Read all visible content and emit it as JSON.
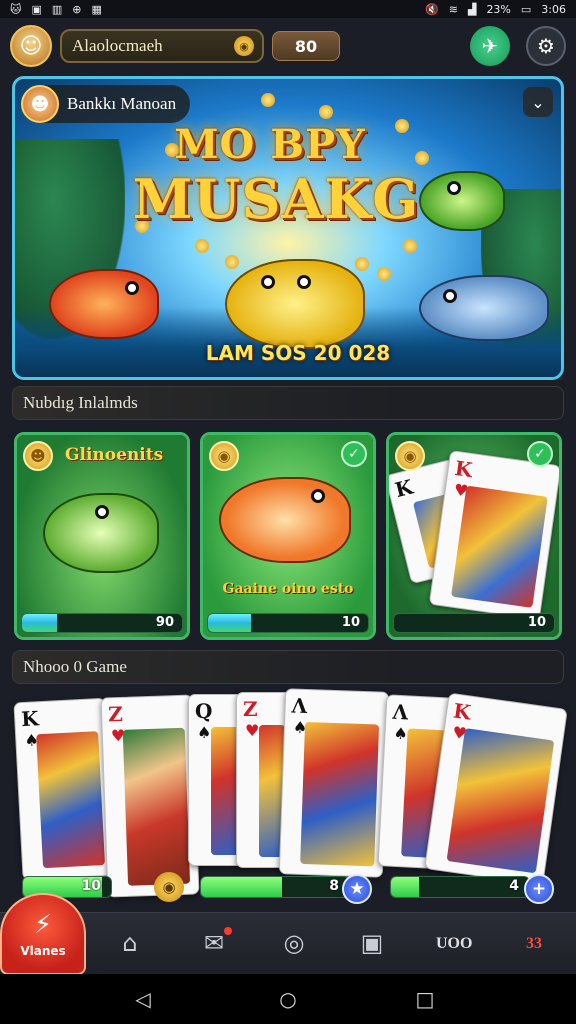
{
  "status_bar": {
    "left_icons": [
      "cat-icon",
      "image-icon",
      "bars-icon",
      "game-icon",
      "square-icon"
    ],
    "right_text": "23%",
    "time": "3:06"
  },
  "top_bar": {
    "username": "Alaolocmaeh",
    "balance": "80"
  },
  "hero": {
    "badge_text": "Bankkı Manoan",
    "title_line1": "MO BPY",
    "title_line2": "MUSAKG",
    "date_text": "LAM SOS 20 028"
  },
  "sections": {
    "featured_title": "Nubdıg Inlalmds",
    "second_title": "Nhooo 0 Game"
  },
  "featured_cards": [
    {
      "title": "Glinoenits",
      "caption": "",
      "progress_value": "90",
      "progress_fraction": 0.22
    },
    {
      "title": "",
      "caption": "Gaaine oino esto",
      "progress_value": "10",
      "progress_fraction": 0.27
    },
    {
      "title": "",
      "caption": "",
      "progress_value": "10",
      "progress_fraction": 0.0
    }
  ],
  "card_row": {
    "cards": [
      {
        "rank": "K",
        "suit": "♠",
        "color": "black"
      },
      {
        "rank": "Z",
        "suit": "♥",
        "color": "red"
      },
      {
        "rank": "Q",
        "suit": "♠",
        "color": "black"
      },
      {
        "rank": "Z",
        "suit": "♥",
        "color": "red"
      },
      {
        "rank": "Λ",
        "suit": "♠",
        "color": "black"
      },
      {
        "rank": "Λ",
        "suit": "♠",
        "color": "black"
      },
      {
        "rank": "K",
        "suit": "♥",
        "color": "red"
      }
    ],
    "bars": [
      {
        "value": "10",
        "fraction": 0.9
      },
      {
        "value": "8",
        "fraction": 0.55
      },
      {
        "value": "4",
        "fraction": 0.2
      }
    ]
  },
  "bottom_nav": {
    "active_label": "Vlanes",
    "text_item": "UOO",
    "right_item": "33"
  }
}
